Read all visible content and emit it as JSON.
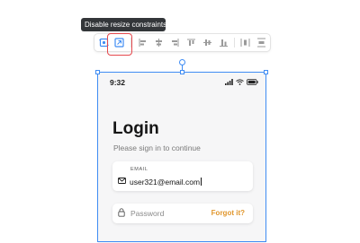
{
  "tooltip": {
    "text": "Disable resize constraints"
  },
  "toolbar": {
    "buttons": [
      {
        "name": "constraints-toggle-icon",
        "active": true
      },
      {
        "name": "disable-resize-constraints-icon",
        "active": true
      },
      {
        "name": "align-left-icon"
      },
      {
        "name": "align-horizontal-center-icon"
      },
      {
        "name": "align-right-icon"
      },
      {
        "name": "align-top-icon"
      },
      {
        "name": "align-vertical-center-icon"
      },
      {
        "name": "align-bottom-icon"
      },
      {
        "name": "distribute-horizontal-icon"
      },
      {
        "name": "distribute-vertical-icon"
      }
    ],
    "accent": "#3f8cf3",
    "highlight_color": "#e5484d"
  },
  "phone": {
    "status_time": "9:32",
    "title": "Login",
    "subtitle": "Please sign in to continue",
    "email": {
      "label": "EMAIL",
      "value": "user321@email.com"
    },
    "password": {
      "placeholder": "Password",
      "forgot_label": "Forgot it?"
    },
    "forgot_color": "#e0962c"
  }
}
